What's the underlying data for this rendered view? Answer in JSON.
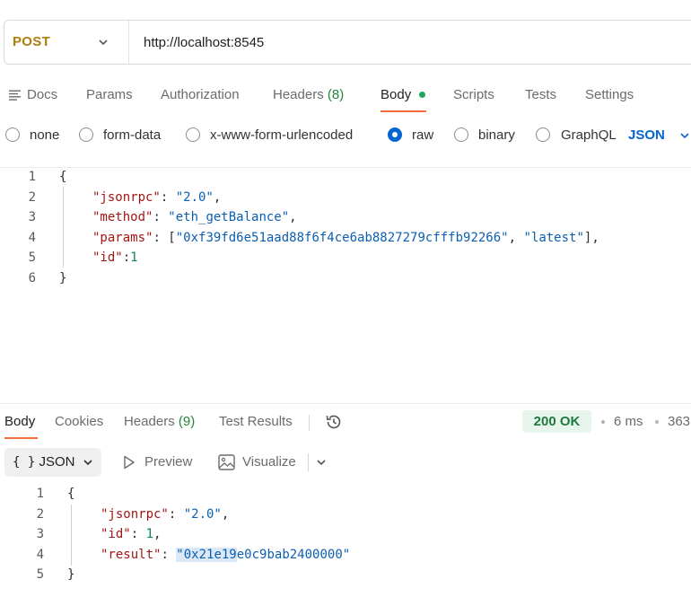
{
  "request": {
    "method": "POST",
    "url": "http://localhost:8545",
    "tabs": {
      "docs": "Docs",
      "params": "Params",
      "authorization": "Authorization",
      "headers": "Headers",
      "headers_count": "(8)",
      "body": "Body",
      "scripts": "Scripts",
      "tests": "Tests",
      "settings": "Settings"
    },
    "body_types": [
      "none",
      "form-data",
      "x-www-form-urlencoded",
      "raw",
      "binary",
      "GraphQL"
    ],
    "selected_body_type": "raw",
    "language": "JSON",
    "code": {
      "line_numbers": [
        "1",
        "2",
        "3",
        "4",
        "5",
        "6"
      ],
      "open_brace": "{",
      "close_brace": "}",
      "jsonrpc_key": "\"jsonrpc\"",
      "jsonrpc_value": "\"2.0\"",
      "method_key": "\"method\"",
      "method_value": "\"eth_getBalance\"",
      "params_key": "\"params\"",
      "params_address": "\"0xf39fd6e51aad88f6f4ce6ab8827279cfffb92266\"",
      "params_tag": "\"latest\"",
      "id_key": "\"id\"",
      "id_value": "1"
    }
  },
  "response": {
    "tabs": {
      "body": "Body",
      "cookies": "Cookies",
      "headers": "Headers",
      "headers_count": "(9)",
      "test_results": "Test Results"
    },
    "status": "200 OK",
    "time": "6 ms",
    "size": "363",
    "format": "JSON",
    "format_glyph": "{ }",
    "preview": "Preview",
    "visualize": "Visualize",
    "code": {
      "line_numbers": [
        "1",
        "2",
        "3",
        "4",
        "5"
      ],
      "open_brace": "{",
      "close_brace": "}",
      "jsonrpc_key": "\"jsonrpc\"",
      "jsonrpc_value": "\"2.0\"",
      "id_key": "\"id\"",
      "id_value": "1",
      "result_key": "\"result\"",
      "result_quote_open": "\"",
      "result_selected": "0x21e19",
      "result_rest": "e0c9bab2400000\""
    }
  },
  "colors": {
    "accent_orange": "#f26b3a",
    "method_color": "#b07d0b",
    "link_blue": "#0265d2",
    "status_green": "#1c7a3e",
    "dot_green": "#22a45d"
  }
}
